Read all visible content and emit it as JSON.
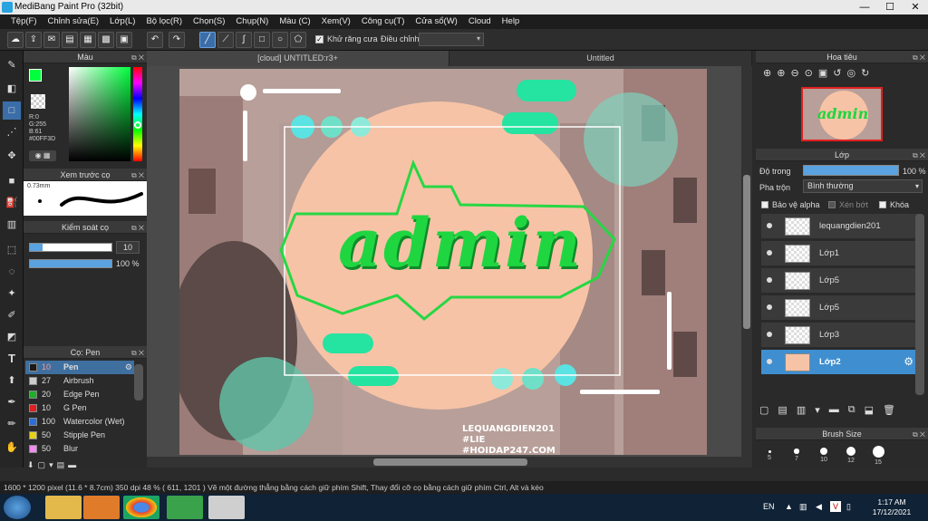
{
  "window": {
    "title": "MediBang Paint Pro (32bit)",
    "minimize": "—",
    "maximize": "☐",
    "close": "✕"
  },
  "menu": [
    "Tệp(F)",
    "Chỉnh sửa(E)",
    "Lớp(L)",
    "Bộ lọc(R)",
    "Chọn(S)",
    "Chụp(N)",
    "Màu (C)",
    "Xem(V)",
    "Công cụ(T)",
    "Cửa sổ(W)",
    "Cloud",
    "Help"
  ],
  "toolbar": {
    "antialias_label": "Khử răng cưa",
    "adjust_label": "Điều chỉnh",
    "adjust_value": ""
  },
  "color_panel": {
    "title": "Màu",
    "r": "R:0",
    "g": "G:255",
    "b": "B:61",
    "hex": "#00FF3D",
    "fg": "#00ff3d",
    "bg": "#ffffff"
  },
  "brush_preview": {
    "title": "Xem trước cọ",
    "size": "0.73mm"
  },
  "brush_control": {
    "title": "Kiểm soát cọ",
    "size": "10",
    "opacity": "100 %"
  },
  "brush_panel": {
    "title": "Cọ: Pen",
    "items": [
      {
        "size": "10",
        "name": "Pen",
        "color": "#1a1a1a",
        "selected": true
      },
      {
        "size": "27",
        "name": "Airbrush",
        "color": "#cccccc"
      },
      {
        "size": "20",
        "name": "Edge Pen",
        "color": "#1fae2a"
      },
      {
        "size": "10",
        "name": "G Pen",
        "color": "#e02020"
      },
      {
        "size": "100",
        "name": "Watercolor (Wet)",
        "color": "#2a6fd8"
      },
      {
        "size": "50",
        "name": "Stipple Pen",
        "color": "#e6d21c"
      },
      {
        "size": "50",
        "name": "Blur",
        "color": "#f08cf0"
      }
    ]
  },
  "tabs": [
    "[cloud] UNTITLED:r3+",
    "Untitled"
  ],
  "canvas_text": {
    "main": "admin",
    "credit1": "LEQUANGDIEN201",
    "credit2": "#LIE",
    "credit3": "#HOIDAP247.COM"
  },
  "navigator": {
    "title": "Hoa tiêu"
  },
  "layer_panel": {
    "title": "Lớp",
    "opacity_label": "Độ trong",
    "opacity_value": "100 %",
    "blend_label": "Pha trộn",
    "blend_value": "Bình thường",
    "protect_alpha": "Bảo vệ alpha",
    "clip": "Xén bớt",
    "lock": "Khóa",
    "layers": [
      {
        "name": "lequangdien201"
      },
      {
        "name": "Lớp1"
      },
      {
        "name": "Lớp5"
      },
      {
        "name": "Lớp5"
      },
      {
        "name": "Lớp3"
      },
      {
        "name": "Lớp2",
        "selected": true
      }
    ]
  },
  "brush_size": {
    "title": "Brush Size",
    "sizes": [
      "5",
      "7",
      "10",
      "12",
      "15"
    ]
  },
  "status": "1600 * 1200 pixel   (11.6 * 8.7cm)   350 dpi   48 %   ( 611, 1201 )   Vẽ một đường thẳng bằng cách giữ phím Shift, Thay đổi cỡ cọ bằng cách giữ phím Ctrl, Alt và kéo",
  "taskbar": {
    "lang": "EN",
    "time": "1:17 AM",
    "date": "17/12/2021"
  }
}
